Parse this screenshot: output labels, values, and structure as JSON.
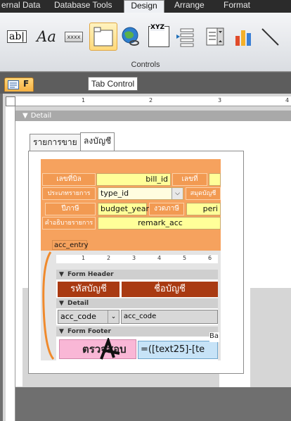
{
  "ribbon": {
    "tabs": [
      "ernal Data",
      "Database Tools",
      "Design",
      "Arrange",
      "Format"
    ],
    "active_tab": "Design",
    "group_label": "Controls",
    "buttons": [
      {
        "icon": "textbox-icon",
        "label": "ab|"
      },
      {
        "icon": "label-icon",
        "label": "Aa"
      },
      {
        "icon": "button-icon",
        "label": "xxxx"
      },
      {
        "icon": "tab-control-icon",
        "selected": true
      },
      {
        "icon": "hyperlink-icon"
      },
      {
        "icon": "web-browser-icon",
        "label": "XYZ"
      },
      {
        "icon": "navigation-icon"
      },
      {
        "icon": "combo-box-icon"
      },
      {
        "icon": "chart-icon"
      },
      {
        "icon": "line-icon"
      }
    ]
  },
  "document": {
    "tab_label": "F",
    "tooltip": "Tab Control",
    "section_detail": "Detail"
  },
  "tab_control": {
    "tabs": [
      "รายการขาย",
      "ลงบัญชี"
    ],
    "active": "ลงบัญชี"
  },
  "form": {
    "labels": {
      "bill_no": "เลขที่บิล",
      "number": "เลขที่",
      "trans_type": "ประเภทรายการ",
      "ledger": "สมุดบัญชี",
      "fiscal_year": "ปีภาษี",
      "period": "งวดภาษี",
      "description": "คำอธิบายรายการ"
    },
    "fields": {
      "bill_id": "bill_id",
      "type_id": "type_id",
      "budget_year": "budget_year",
      "period": "peri",
      "remark": "remark_acc"
    },
    "subform_label": "acc_entry"
  },
  "subform": {
    "ruler_marks": [
      "1",
      "2",
      "3",
      "4",
      "5",
      "6"
    ],
    "form_header": "Form Header",
    "detail": "Detail",
    "form_footer": "Form Footer",
    "col_account_code": "รหัสบัญชี",
    "col_account_name": "ชื่อบัญชี",
    "combo_value": "acc_code",
    "combo_text": "acc_code",
    "footer_label": "ตรวจสอบ",
    "footer_expr": "=([text25]-[te",
    "footer_extra": "Ba"
  },
  "ruler": {
    "marks": [
      "1",
      "2",
      "3",
      "4"
    ]
  },
  "colors": {
    "ribbon_bg": "#dadde2",
    "form_orange": "#f6a25e",
    "field_yellow": "#ffff99",
    "header_brown": "#a93a12",
    "footer_pink": "#f9b7d6",
    "footer_blue": "#c7e3f7"
  }
}
